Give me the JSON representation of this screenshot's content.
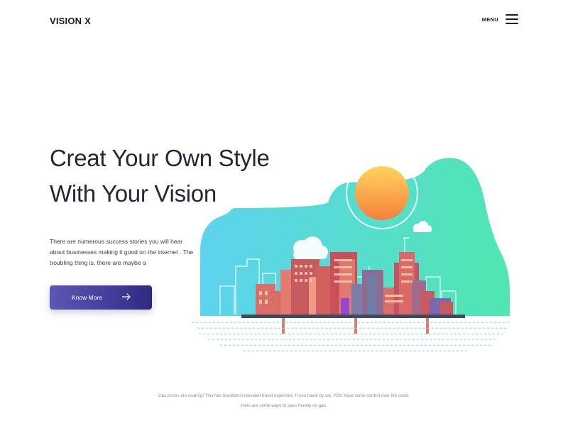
{
  "header": {
    "brand": "VISION X",
    "menu_label": "MENU"
  },
  "hero": {
    "title_line_1": "Creat Your Own Style",
    "title_line_2": "With Your Vision",
    "description": "There are numerous success stories you will hear about businesses making it good on the internet . The troubling thing is, there are maybe a",
    "cta_label": "Know More"
  },
  "footer": {
    "line_1": "Gas prices are soaring! This has resulted in elevated travel expenses. If you travel by car, YOU have some control over the costs.",
    "line_2": "Here are some ways to save money on gas."
  },
  "icons": {
    "menu": "hamburger-icon",
    "cta": "arrow-right-icon"
  },
  "colors": {
    "text": "#24263a",
    "button_start": "#5d58b1",
    "button_end": "#2f2a7e",
    "blob_start": "#5ed3ee",
    "blob_end": "#4fe6b0",
    "sun_top": "#ffd45e",
    "sun_bottom": "#f5803a"
  }
}
